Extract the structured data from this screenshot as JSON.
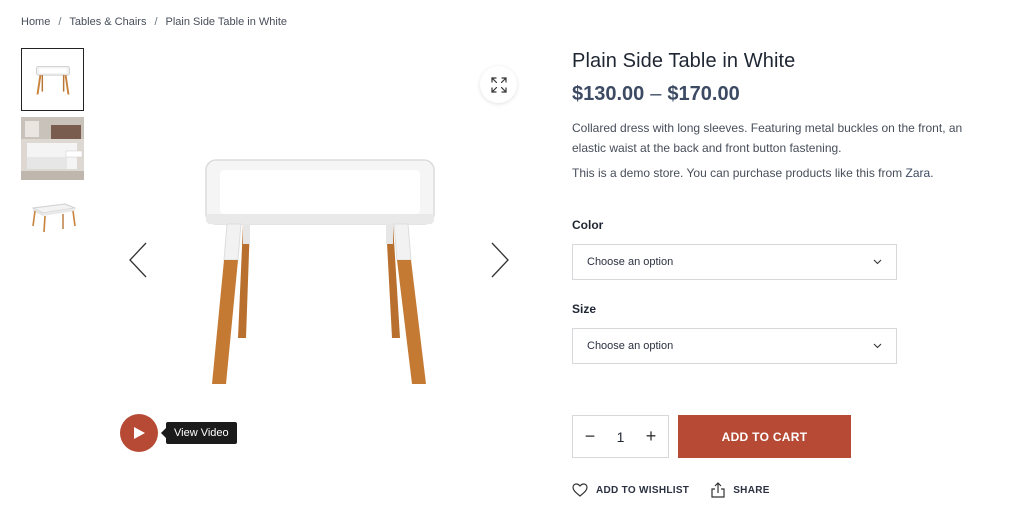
{
  "breadcrumb": {
    "items": [
      "Home",
      "Tables & Chairs",
      "Plain Side Table in White"
    ],
    "separator": "/"
  },
  "gallery": {
    "thumbnails": [
      "table-white-front",
      "bedroom-scene",
      "table-white-angle"
    ],
    "active_index": 0,
    "zoom_icon": "expand-icon",
    "prev_icon": "chevron-left-icon",
    "next_icon": "chevron-right-icon"
  },
  "video": {
    "label": "View Video",
    "icon": "play-icon"
  },
  "product": {
    "title": "Plain Side Table in White",
    "price_low": "$130.00",
    "price_dash": "–",
    "price_high": "$170.00",
    "description": "Collared dress with long sleeves. Featuring metal buckles on the front, an elastic waist at the back and front button fastening.",
    "demo_text": "This is a demo store. You can purchase products like this from",
    "demo_brand": "Zara",
    "demo_end": "."
  },
  "options": {
    "color_label": "Color",
    "color_value": "Choose an option",
    "size_label": "Size",
    "size_value": "Choose an option"
  },
  "cart": {
    "minus": "−",
    "quantity": "1",
    "plus": "+",
    "add_label": "ADD TO CART"
  },
  "actions": {
    "wishlist": "ADD TO WISHLIST",
    "share": "SHARE"
  },
  "colors": {
    "accent": "#b64a35",
    "price": "#3c4a63",
    "text": "#1f2633"
  }
}
